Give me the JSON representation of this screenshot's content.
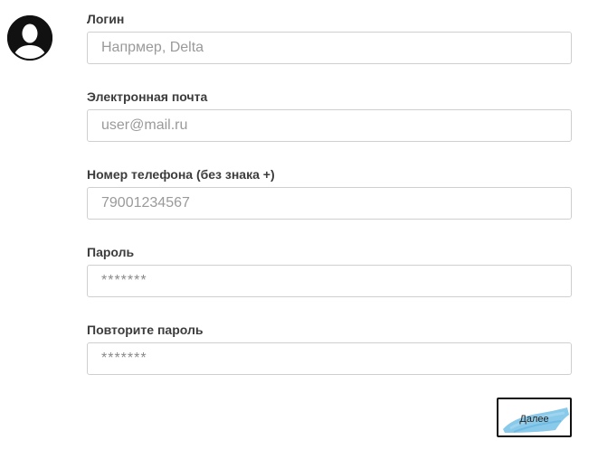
{
  "form": {
    "login": {
      "label": "Логин",
      "placeholder": "Напрмер, Delta"
    },
    "email": {
      "label": "Электронная почта",
      "placeholder": "user@mail.ru"
    },
    "phone": {
      "label": "Номер телефона (без знака +)",
      "placeholder": "79001234567"
    },
    "password": {
      "label": "Пароль",
      "placeholder": "*******"
    },
    "password_repeat": {
      "label": "Повторите пароль",
      "placeholder": "*******"
    }
  },
  "actions": {
    "next_label": "Далее"
  },
  "colors": {
    "button_brush": "#7cc3e8",
    "avatar": "#111111",
    "input_border": "#cfcfcf",
    "label_text": "#3c3c3c"
  },
  "icons": {
    "avatar": "user-avatar-icon"
  }
}
